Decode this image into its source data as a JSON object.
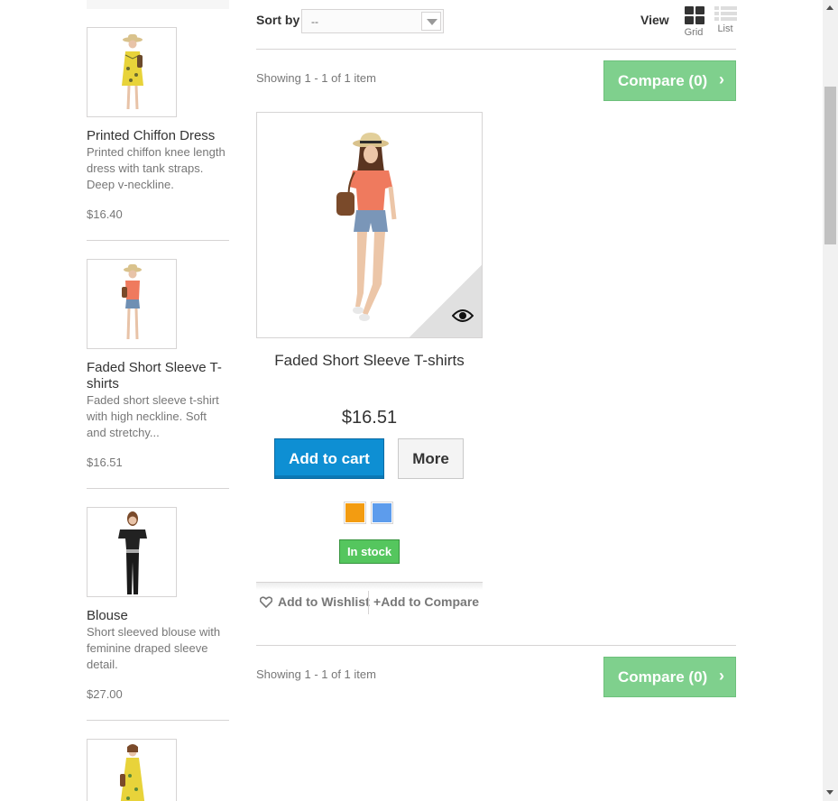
{
  "sidebar": {
    "items": [
      {
        "name": "Printed Chiffon Dress",
        "desc": "Printed chiffon knee length dress with tank straps. Deep v-neckline.",
        "price": "$16.40"
      },
      {
        "name": "Faded Short Sleeve T-shirts",
        "desc": "Faded short sleeve t-shirt with high neckline. Soft and stretchy...",
        "price": "$16.51"
      },
      {
        "name": "Blouse",
        "desc": "Short sleeved blouse with feminine draped sleeve detail.",
        "price": "$27.00"
      }
    ]
  },
  "toolbar": {
    "sort_label": "Sort by",
    "sort_value": "--",
    "view_label": "View",
    "grid_label": "Grid",
    "list_label": "List"
  },
  "listing": {
    "showing_top": "Showing 1 - 1 of 1 item",
    "showing_bottom": "Showing 1 - 1 of 1 item",
    "compare_label": "Compare (0)"
  },
  "product": {
    "name": "Faded Short Sleeve T-shirts",
    "price": "$16.51",
    "add_to_cart": "Add to cart",
    "more": "More",
    "colors": [
      "#f39c11",
      "#5d9cec"
    ],
    "stock": "In stock",
    "wishlist": "Add to Wishlist",
    "compare": "Add to Compare"
  }
}
